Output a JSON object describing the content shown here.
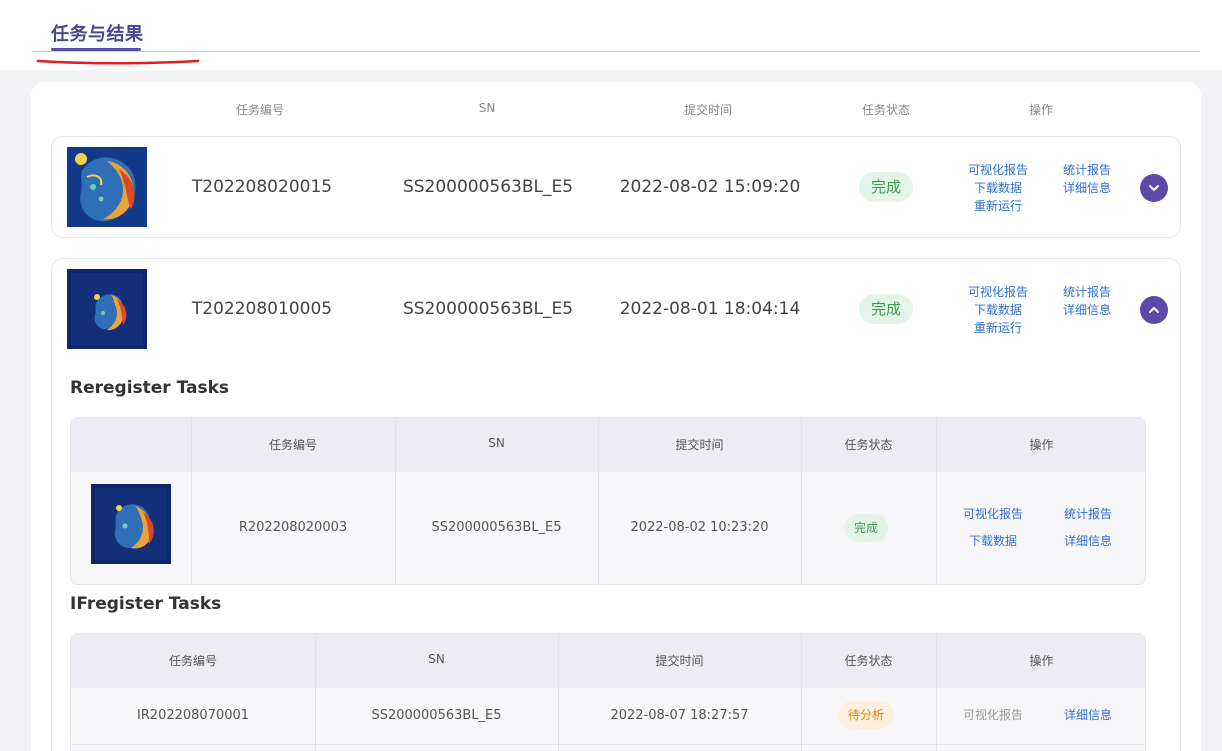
{
  "page": {
    "tab_title": "任务与结果"
  },
  "columns": {
    "task_id": "任务编号",
    "sn": "SN",
    "submit_time": "提交时间",
    "status": "任务状态",
    "actions": "操作"
  },
  "tasks": [
    {
      "task_id": "T202208020015",
      "sn": "SS200000563BL_E5",
      "submit_time": "2022-08-02 15:09:20",
      "status": "完成",
      "actions": {
        "viz_report": "可视化报告",
        "stats_report": "统计报告",
        "download": "下载数据",
        "details": "详细信息",
        "rerun": "重新运行"
      },
      "expanded": false
    },
    {
      "task_id": "T202208010005",
      "sn": "SS200000563BL_E5",
      "submit_time": "2022-08-01 18:04:14",
      "status": "完成",
      "actions": {
        "viz_report": "可视化报告",
        "stats_report": "统计报告",
        "download": "下载数据",
        "details": "详细信息",
        "rerun": "重新运行"
      },
      "expanded": true
    }
  ],
  "reregister": {
    "title": "Reregister Tasks",
    "columns": {
      "task_id": "任务编号",
      "sn": "SN",
      "submit_time": "提交时间",
      "status": "任务状态",
      "actions": "操作"
    },
    "rows": [
      {
        "task_id": "R202208020003",
        "sn": "SS200000563BL_E5",
        "submit_time": "2022-08-02 10:23:20",
        "status": "完成",
        "actions": {
          "viz_report": "可视化报告",
          "stats_report": "统计报告",
          "download": "下载数据",
          "details": "详细信息"
        }
      }
    ]
  },
  "ifregister": {
    "title": "IFregister Tasks",
    "columns": {
      "task_id": "任务编号",
      "sn": "SN",
      "submit_time": "提交时间",
      "status": "任务状态",
      "actions": "操作"
    },
    "rows": [
      {
        "task_id": "IR202208070001",
        "sn": "SS200000563BL_E5",
        "submit_time": "2022-08-07 18:27:57",
        "status": "待分析",
        "actions": {
          "viz_report": "可视化报告",
          "details": "详细信息"
        }
      }
    ]
  },
  "colors": {
    "accent": "#5d4aa8",
    "link": "#2f6fd0",
    "done_bg": "#e4f5e8",
    "done_text": "#3a9a50",
    "pending_bg": "#fdf0dc",
    "pending_text": "#d88a1a",
    "annotation": "#e02020"
  },
  "icons": {
    "toggle_collapsed": "chevron-down-icon",
    "toggle_expanded": "chevron-up-icon"
  }
}
